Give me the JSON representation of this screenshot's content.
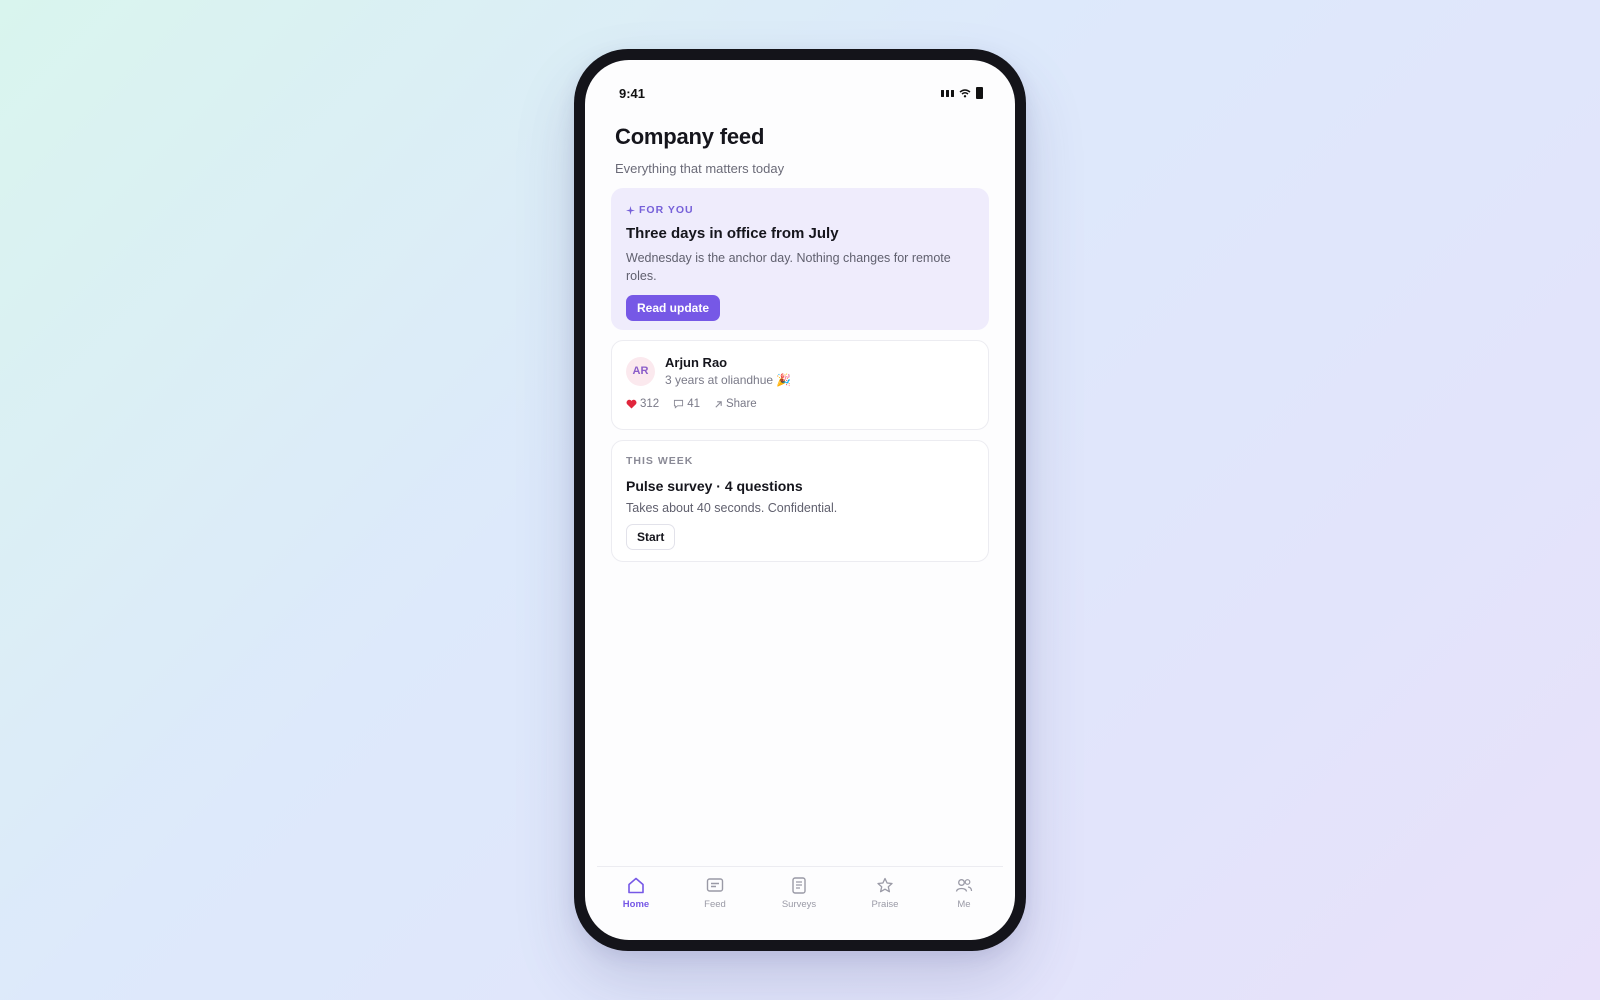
{
  "status": {
    "time": "9:41"
  },
  "header": {
    "title": "Company feed",
    "subtitle": "Everything that matters today"
  },
  "for_you": {
    "eyebrow_icon": "sparkle-icon",
    "eyebrow": "FOR YOU",
    "title": "Three days in office from July",
    "body": "Wednesday is the anchor day. Nothing changes for remote roles.",
    "button": "Read update"
  },
  "post": {
    "initials": "AR",
    "name": "Arjun Rao",
    "meta": "3 years at oliandhue 🎉",
    "likes": "312",
    "comments": "41",
    "share": "Share"
  },
  "survey": {
    "eyebrow": "THIS WEEK",
    "title": "Pulse survey · 4 questions",
    "body": "Takes about 40 seconds. Confidential.",
    "button": "Start"
  },
  "tabs": [
    {
      "label": "Home",
      "icon": "home-icon",
      "active": true
    },
    {
      "label": "Feed",
      "icon": "feed-icon",
      "active": false
    },
    {
      "label": "Surveys",
      "icon": "surveys-icon",
      "active": false
    },
    {
      "label": "Praise",
      "icon": "star-icon",
      "active": false
    },
    {
      "label": "Me",
      "icon": "people-icon",
      "active": false
    }
  ],
  "colors": {
    "accent": "#7658e6",
    "card_tint": "#efecfc",
    "text": "#15151c",
    "muted": "#6b6b78"
  }
}
